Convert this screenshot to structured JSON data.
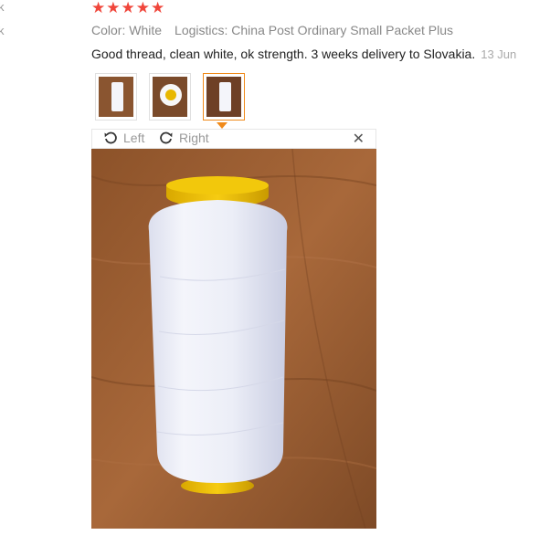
{
  "left_fragments": {
    "line1": "k",
    "line2": "k"
  },
  "rating": {
    "stars": 5,
    "star_glyph": "★",
    "star_color": "#f0463b"
  },
  "meta": {
    "color_label": "Color: White",
    "logistics_label": "Logistics: China Post Ordinary Small Packet Plus"
  },
  "review": {
    "text": "Good thread, clean white, ok strength. 3 weeks delivery to Slovakia.",
    "date": "13 Jun"
  },
  "thumbnails": [
    {
      "icon": "thread-spool-side-thumbnail",
      "active": false
    },
    {
      "icon": "thread-spool-top-thumbnail",
      "active": false
    },
    {
      "icon": "thread-spool-tall-thumbnail",
      "active": true
    }
  ],
  "viewer": {
    "rotate_left_label": "Left",
    "rotate_right_label": "Right",
    "close_glyph": "✕"
  },
  "colors": {
    "accent": "#f08a1a",
    "wood": "#9a5e32",
    "thread": "#f1f2f8",
    "spool_cap": "#f0c400"
  }
}
